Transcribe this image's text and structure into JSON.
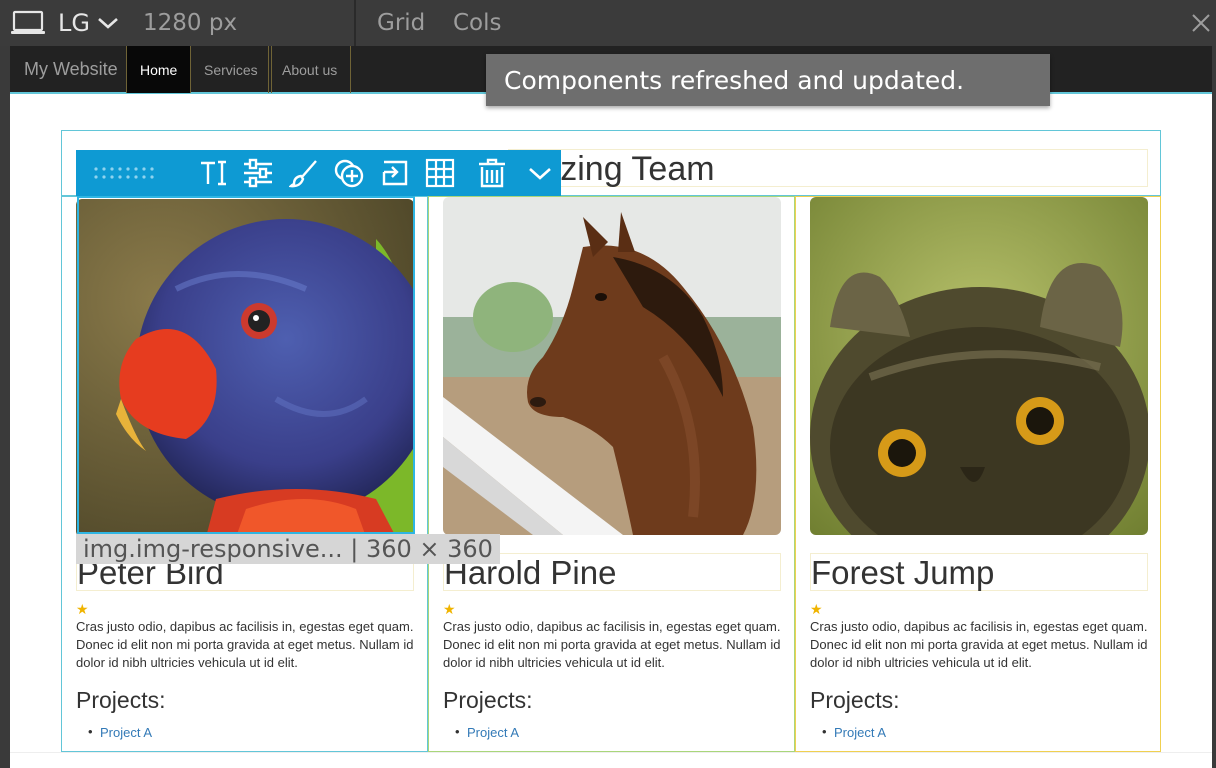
{
  "editor_bar": {
    "device_name": "LG",
    "device_width": "1280 px",
    "grid_label": "Grid",
    "cols_label": "Cols",
    "icons": [
      "laptop-icon",
      "chevron-down-icon",
      "close-icon"
    ]
  },
  "site_nav": {
    "brand": "My Website",
    "items": [
      {
        "label": "Home",
        "active": true
      },
      {
        "label": "Services",
        "active": false
      },
      {
        "label": "About us",
        "active": false
      }
    ]
  },
  "toast": {
    "message": "Components refreshed and updated."
  },
  "heading": {
    "visible_text": "mazing Team"
  },
  "selection": {
    "tooltip": "img.img-responsive... | 360 × 360"
  },
  "toolbar": {
    "icons": [
      "drag-handle-icon",
      "text-icon",
      "settings-sliders-icon",
      "brush-icon",
      "add-circle-icon",
      "import-icon",
      "grid-icon",
      "trash-icon",
      "chevron-down-icon"
    ]
  },
  "team": [
    {
      "name": "Peter Bird",
      "photo": "parrot",
      "stars": "★",
      "bio": "Cras justo odio, dapibus ac facilisis in, egestas eget quam. Donec id elit non mi porta gravida at eget metus. Nullam id dolor id nibh ultricies vehicula ut id elit.",
      "projects_title": "Projects:",
      "projects": [
        "Project A"
      ]
    },
    {
      "name": "Harold Pine",
      "photo": "horse",
      "stars": "★",
      "bio": "Cras justo odio, dapibus ac facilisis in, egestas eget quam. Donec id elit non mi porta gravida at eget metus. Nullam id dolor id nibh ultricies vehicula ut id elit.",
      "projects_title": "Projects:",
      "projects": [
        "Project A"
      ]
    },
    {
      "name": "Forest Jump",
      "photo": "owl",
      "stars": "★",
      "bio": "Cras justo odio, dapibus ac facilisis in, egestas eget quam. Donec id elit non mi porta gravida at eget metus. Nullam id dolor id nibh ultricies vehicula ut id elit.",
      "projects_title": "Projects:",
      "projects": [
        "Project A"
      ]
    }
  ],
  "colors": {
    "toolbar_blue": "#0e9ad3",
    "selection_outline": "#62c6d8",
    "link_blue": "#337ab7",
    "star_gold": "#f0b400"
  }
}
